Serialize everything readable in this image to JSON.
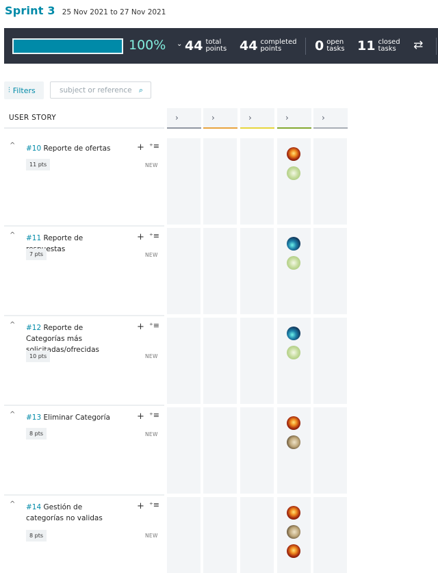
{
  "sprint": {
    "title": "Sprint 3",
    "dates": "25 Nov 2021 to 27 Nov 2021"
  },
  "summary": {
    "progress_fraction": 1.0,
    "progress_text": "100%",
    "total_points": "44",
    "total_label": "total points",
    "completed_points": "44",
    "completed_label": "completed points",
    "open_tasks": "0",
    "open_label": "open tasks",
    "closed_tasks": "11",
    "closed_label": "closed tasks"
  },
  "toolbar": {
    "filters_label": "Filters",
    "search_placeholder": "subject or reference"
  },
  "board": {
    "user_story_header": "USER STORY",
    "status_columns": [
      {
        "color": "#8f96a1"
      },
      {
        "color": "#e8a33d"
      },
      {
        "color": "#e6d53a"
      },
      {
        "color": "#83a82f"
      },
      {
        "color": "#a7adb5"
      }
    ],
    "stories": [
      {
        "ref": "#10",
        "title": "Reporte de ofertas",
        "points": "11 pts",
        "status": "NEW",
        "avatars": [
          "fire",
          "green"
        ]
      },
      {
        "ref": "#11",
        "title": "Reporte de respuestas",
        "points": "7 pts",
        "status": "NEW",
        "avatars": [
          "blue",
          "green"
        ]
      },
      {
        "ref": "#12",
        "title": "Reporte de Categorías más solicitadas/ofrecidas",
        "points": "10 pts",
        "status": "NEW",
        "avatars": [
          "blue",
          "green"
        ]
      },
      {
        "ref": "#13",
        "title": "Eliminar Categoría",
        "points": "8 pts",
        "status": "NEW",
        "avatars": [
          "fire",
          "cat"
        ]
      },
      {
        "ref": "#14",
        "title": "Gestión de categorías no validas",
        "points": "8 pts",
        "status": "NEW",
        "avatars": [
          "fire",
          "cat",
          "fire"
        ]
      }
    ]
  }
}
